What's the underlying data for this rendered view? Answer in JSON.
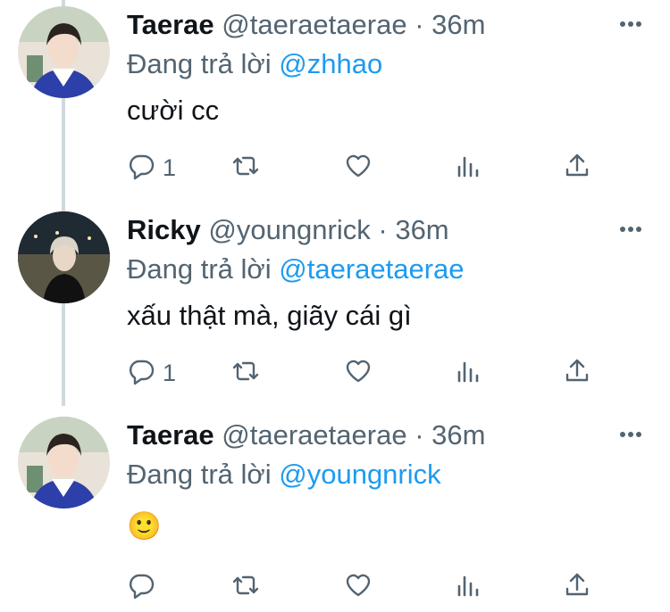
{
  "colors": {
    "accent": "#1d9bf0",
    "muted": "#536471",
    "text": "#0f1419",
    "thread_line": "#cfd9de"
  },
  "tweets": [
    {
      "display_name": "Taerae",
      "handle": "@taeraetaerae",
      "separator": "·",
      "time": "36m",
      "reply_prefix": "Đang trả lời",
      "reply_to": "@zhhao",
      "text": "cười cc",
      "reply_count": "1",
      "avatar": "avatar-taerae"
    },
    {
      "display_name": "Ricky",
      "handle": "@youngnrick",
      "separator": "·",
      "time": "36m",
      "reply_prefix": "Đang trả lời",
      "reply_to": "@taeraetaerae",
      "text": "xấu thật mà, giãy cái gì",
      "reply_count": "1",
      "avatar": "avatar-ricky"
    },
    {
      "display_name": "Taerae",
      "handle": "@taeraetaerae",
      "separator": "·",
      "time": "36m",
      "reply_prefix": "Đang trả lời",
      "reply_to": "@youngnrick",
      "text": "🙂",
      "reply_count": "",
      "avatar": "avatar-taerae"
    }
  ],
  "icons": [
    "more-icon",
    "reply-icon",
    "retweet-icon",
    "like-icon",
    "analytics-icon",
    "share-icon"
  ]
}
